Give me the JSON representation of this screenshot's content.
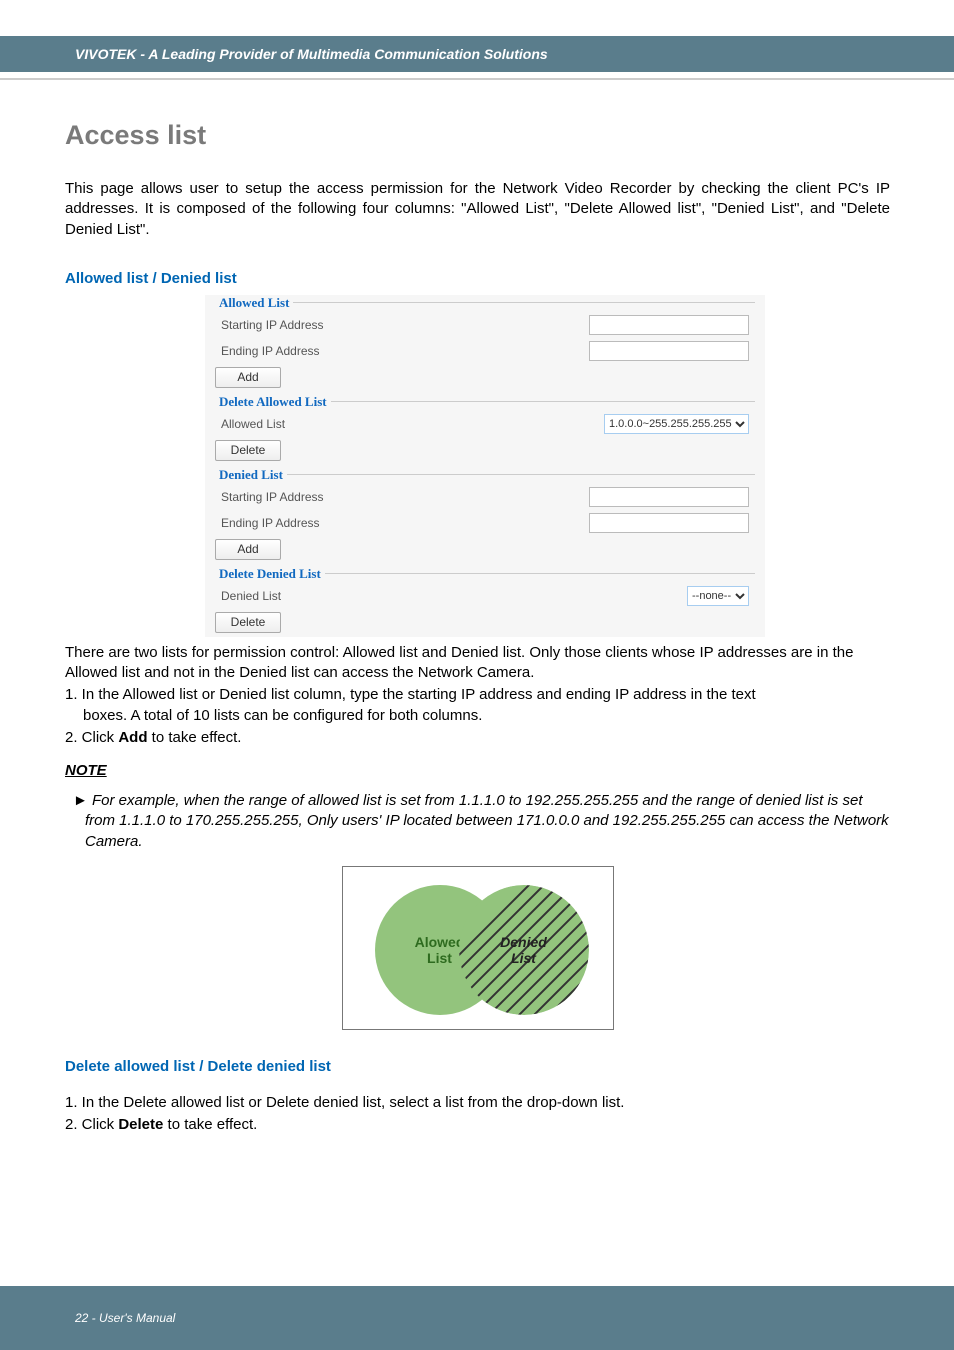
{
  "header": {
    "brand": "VIVOTEK - A Leading Provider of Multimedia Communication Solutions"
  },
  "title": "Access list",
  "intro": "This page allows user to setup the access permission for the Network Video Recorder by checking the client PC's IP addresses. It is composed of the following four columns: \"Allowed List\", \"Delete Allowed list\", \"Denied List\", and \"Delete Denied List\".",
  "section1_head": "Allowed list / Denied list",
  "ui": {
    "allowed_legend": "Allowed List",
    "starting_label": "Starting IP Address",
    "ending_label": "Ending IP Address",
    "add_btn": "Add",
    "delete_allowed_legend": "Delete Allowed List",
    "allowed_list_label": "Allowed List",
    "allowed_select_value": "1.0.0.0~255.255.255.255",
    "delete_btn": "Delete",
    "denied_legend": "Denied List",
    "delete_denied_legend": "Delete Denied List",
    "denied_list_label": "Denied List",
    "denied_select_value": "--none--"
  },
  "para_after_ui": "There are two lists for permission control: Allowed list and Denied list. Only those clients whose IP addresses are in the Allowed list and not in the Denied list can access the Network Camera.",
  "steps1": {
    "s1a": "1. In the Allowed list or Denied list column, type the starting IP address and ending IP address in the text",
    "s1b": "boxes. A total of 10 lists can be configured for both columns.",
    "s2_pre": "2. Click ",
    "s2_bold": "Add",
    "s2_post": " to take effect."
  },
  "note_head": "NOTE",
  "note_body": "► For example, when the range of allowed list is set from 1.1.1.0 to 192.255.255.255 and the range of denied list is set from 1.1.1.0 to 170.255.255.255, Only users' IP located between 171.0.0.0 and 192.255.255.255 can access the Network Camera.",
  "diagram": {
    "allowed1": "Alowed",
    "allowed2": "List",
    "denied1": "Denied",
    "denied2": "List"
  },
  "section2_head": "Delete allowed list / Delete denied list",
  "steps2": {
    "s1": "1. In the Delete allowed list or Delete denied list, select a list from the drop-down list.",
    "s2_pre": "2. Click ",
    "s2_bold": "Delete",
    "s2_post": " to take effect."
  },
  "footer": {
    "page": "22 - User's Manual"
  }
}
